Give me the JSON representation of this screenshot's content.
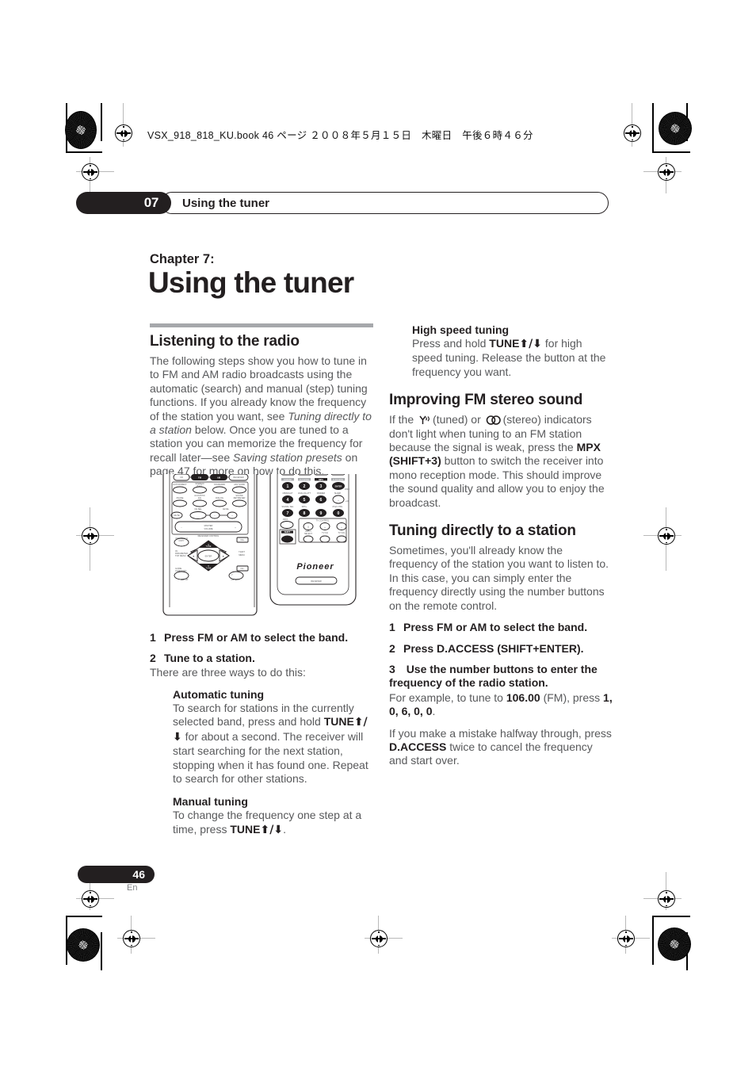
{
  "print": {
    "file_header": "VSX_918_818_KU.book  46 ページ  ２００８年５月１５日　木曜日　午後６時４６分"
  },
  "running_header": {
    "chapter_number": "07",
    "title": "Using the tuner"
  },
  "chapter": {
    "label": "Chapter 7:",
    "title": "Using the tuner"
  },
  "left_column": {
    "section_heading": "Listening to the radio",
    "intro_parts": {
      "p1a": "The following steps show you how to tune in to FM and AM radio broadcasts using the automatic (search) and manual (step) tuning functions. If you already know the frequency of the station you want, see ",
      "p1_italic1": "Tuning directly to a station",
      "p1b": " below. Once you are tuned to a station you can memorize the frequency for recall later—see ",
      "p1_italic2": "Saving station presets",
      "p1c": " on page 47 for more on how to do this."
    },
    "steps": [
      {
        "n": "1",
        "text": "Press FM or AM to select the band."
      },
      {
        "n": "2",
        "text": "Tune to a station."
      }
    ],
    "after_step2": "There are three ways to do this:",
    "automatic": {
      "heading": "Automatic tuning",
      "a": "To search for stations in the currently selected band, press and hold ",
      "tune": "TUNE",
      "b": " for about a second. The receiver will start searching for the next station, stopping when it has found one. Repeat to search for other stations."
    },
    "manual": {
      "heading": "Manual tuning",
      "a": "To change the frequency one step at a time, press ",
      "tune": "TUNE",
      "b": "."
    }
  },
  "right_column": {
    "high_speed": {
      "heading": "High speed tuning",
      "a": "Press and hold ",
      "tune": "TUNE",
      "b": " for high speed tuning. Release the button at the frequency you want."
    },
    "fm_stereo": {
      "heading": "Improving FM stereo sound",
      "a": "If the ",
      "tuned_label": "(tuned)",
      "or": " or ",
      "stereo_label": "(stereo) indicators",
      "b": "don't light when tuning to an FM station because the signal is weak, press the ",
      "mpx": "MPX (SHIFT+3)",
      "c": " button to switch the receiver into mono reception mode. This should improve the sound quality and allow you to enjoy the broadcast."
    },
    "direct": {
      "heading": "Tuning directly to a station",
      "intro": "Sometimes, you'll already know the frequency of the station you want to listen to. In this case, you can simply enter the frequency directly using the number buttons on the remote control.",
      "steps": [
        {
          "n": "1",
          "text": "Press FM or AM to select the band."
        },
        {
          "n": "2",
          "text": "Press D.ACCESS (SHIFT+ENTER)."
        },
        {
          "n": "3",
          "text": "Use the number buttons to enter the frequency of the radio station."
        }
      ],
      "example_a": "For example, to tune to ",
      "example_freq": "106.00",
      "example_b": " (FM), press ",
      "example_digits": "1, 0, 6, 0, 0",
      "example_c": ".",
      "mistake_a": "If you make a mistake halfway through, press ",
      "mistake_btn": "D.ACCESS",
      "mistake_b": " twice to cancel the frequency and start over."
    }
  },
  "remote": {
    "brand": "Pioneer",
    "mode_label": "RECEIVER",
    "source_buttons": [
      "CD",
      "FM",
      "AM",
      "RECEIVER"
    ],
    "left_labels": [
      "AUTO/DIRECT",
      "STEREO/A.L.C.",
      "STANDARD",
      "ADV SURR",
      "PHASE",
      "ACOUSTIC EQ",
      "DIALOG",
      "SOUND RETRIEVER",
      "MUTE",
      "CH SEL",
      "LEVEL",
      "MASTER VOLUME",
      "RECEIVER CONTROL",
      "ONE TOUCH COPY",
      "CH+",
      "AV PARAMETER TOP MENU",
      "T.EDIT MENU",
      "GUIDE CATEGORY",
      "CH-",
      "SETUP",
      "RETURN",
      "ENTER",
      "TUNE",
      "ST"
    ],
    "numeric_top_labels": [
      "CD/DISP",
      "CH LEVEL",
      "MPX",
      "D.ACCESS"
    ],
    "number_keys": [
      "1",
      "2",
      "3",
      "4",
      "5",
      "6",
      "7",
      "8",
      "9",
      "0"
    ],
    "numeric_row_labels": [
      "MIDNIGHT",
      "ANALOG ATT",
      "DIMMER",
      "SLEEP",
      "SIGNAL SEL",
      "SPK+",
      "iPod CTRL",
      "INFO"
    ],
    "enter_label": "ENTER",
    "shift_label": "SHIFT",
    "tv_control": {
      "group": "TV CONTROL",
      "input_select": "INPUT SELECT",
      "tv_ch": "TV CH",
      "tv_vol": "TV VOL"
    }
  },
  "footer": {
    "page_number": "46",
    "language": "En"
  },
  "colors": {
    "ink": "#231f20",
    "body_text": "#58595b",
    "rule": "#a6a8ab"
  }
}
